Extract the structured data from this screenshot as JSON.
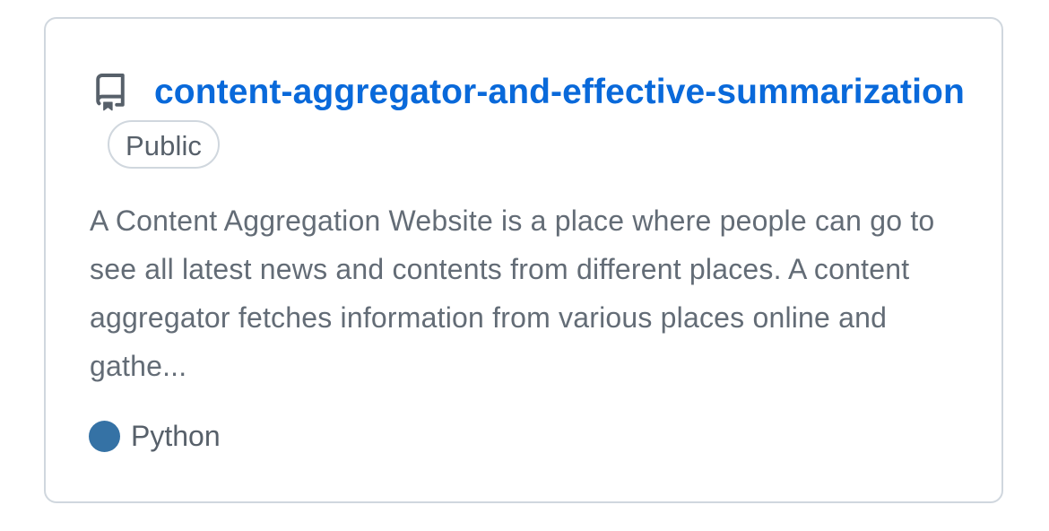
{
  "repo": {
    "name": "content-aggregator-and-effective-summarization",
    "visibility": "Public",
    "description": "A Content Aggregation Website is a place where people can go to see all latest news and contents from different places. A content aggregator fetches information from various places online and gathe...",
    "language": {
      "name": "Python",
      "color": "#3572A5"
    },
    "icon": "repo-icon"
  },
  "colors": {
    "link": "#0969da",
    "border": "#d0d7de",
    "muted_text": "#636c76"
  }
}
